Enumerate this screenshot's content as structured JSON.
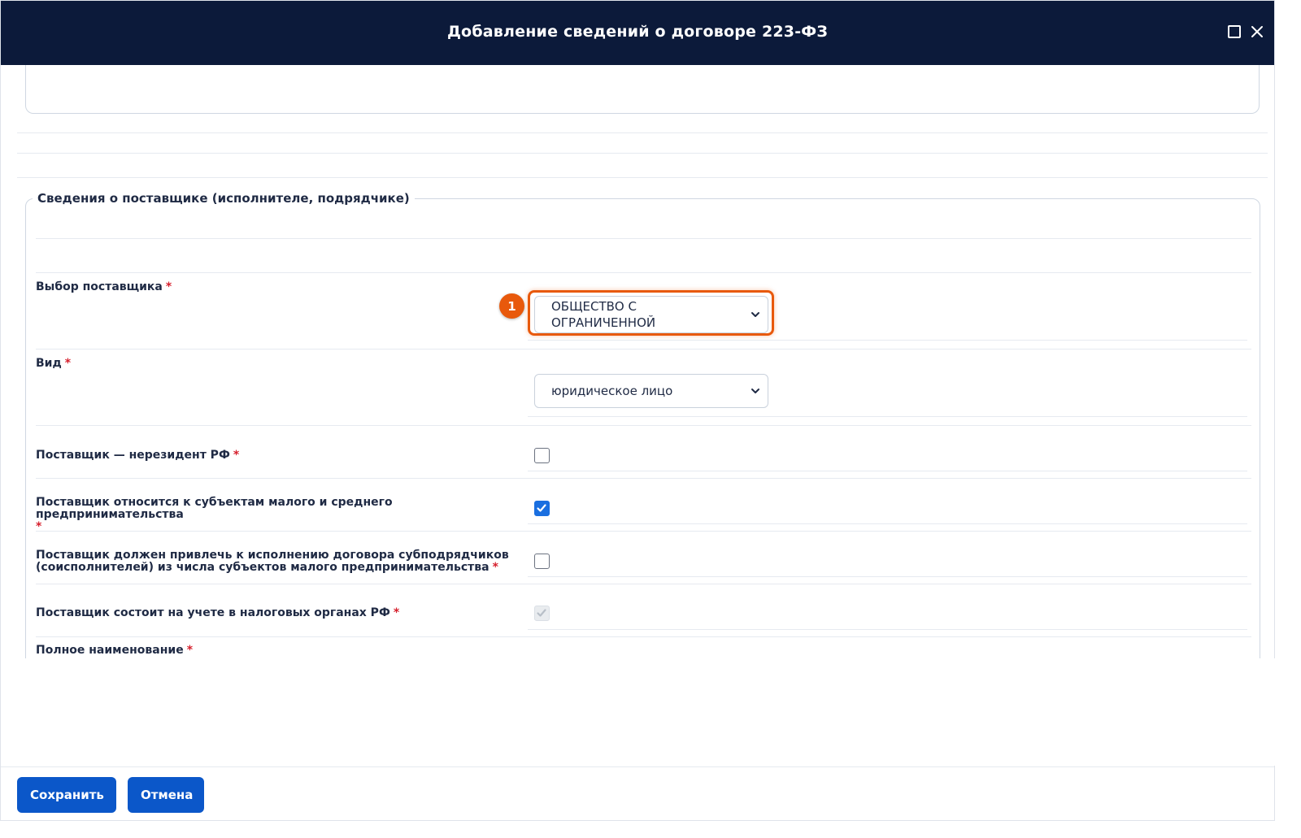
{
  "dialog": {
    "title": "Добавление сведений о договоре 223-ФЗ"
  },
  "supplier_section": {
    "legend": "Сведения о поставщике (исполнителе, подрядчике)",
    "fields": {
      "supplier_choice": {
        "label": "Выбор поставщика",
        "required_mark": "*",
        "value_line1": "ОБЩЕСТВО С",
        "value_line2": "ОГРАНИЧЕННОЙ"
      },
      "kind": {
        "label": "Вид",
        "required_mark": "*",
        "value": "юридическое лицо"
      },
      "non_resident": {
        "label": "Поставщик — нерезидент РФ",
        "required_mark": "*",
        "checked": false
      },
      "sme": {
        "label": "Поставщик относится к субъектам малого и среднего предпринимательства",
        "required_mark": "*",
        "checked": true
      },
      "subcontractors": {
        "label_line1": "Поставщик должен привлечь к исполнению договора субподрядчиков",
        "label_line2": "(соисполнителей) из числа субъектов малого предпринимательства",
        "required_mark": "*",
        "checked": false
      },
      "tax_registered": {
        "label": "Поставщик состоит на учете в налоговых органах РФ",
        "required_mark": "*",
        "checked": true,
        "disabled": true
      },
      "full_name": {
        "label": "Полное наименование",
        "required_mark": "*"
      }
    }
  },
  "annotation": {
    "step_number": "1",
    "color": "#e8590c"
  },
  "footer": {
    "save_label": "Сохранить",
    "cancel_label": "Отмена"
  },
  "colors": {
    "titlebar": "#0c1a3a",
    "primary_button": "#0b57c9",
    "checkbox_checked": "#1a6fe0",
    "required": "#d6202d"
  }
}
